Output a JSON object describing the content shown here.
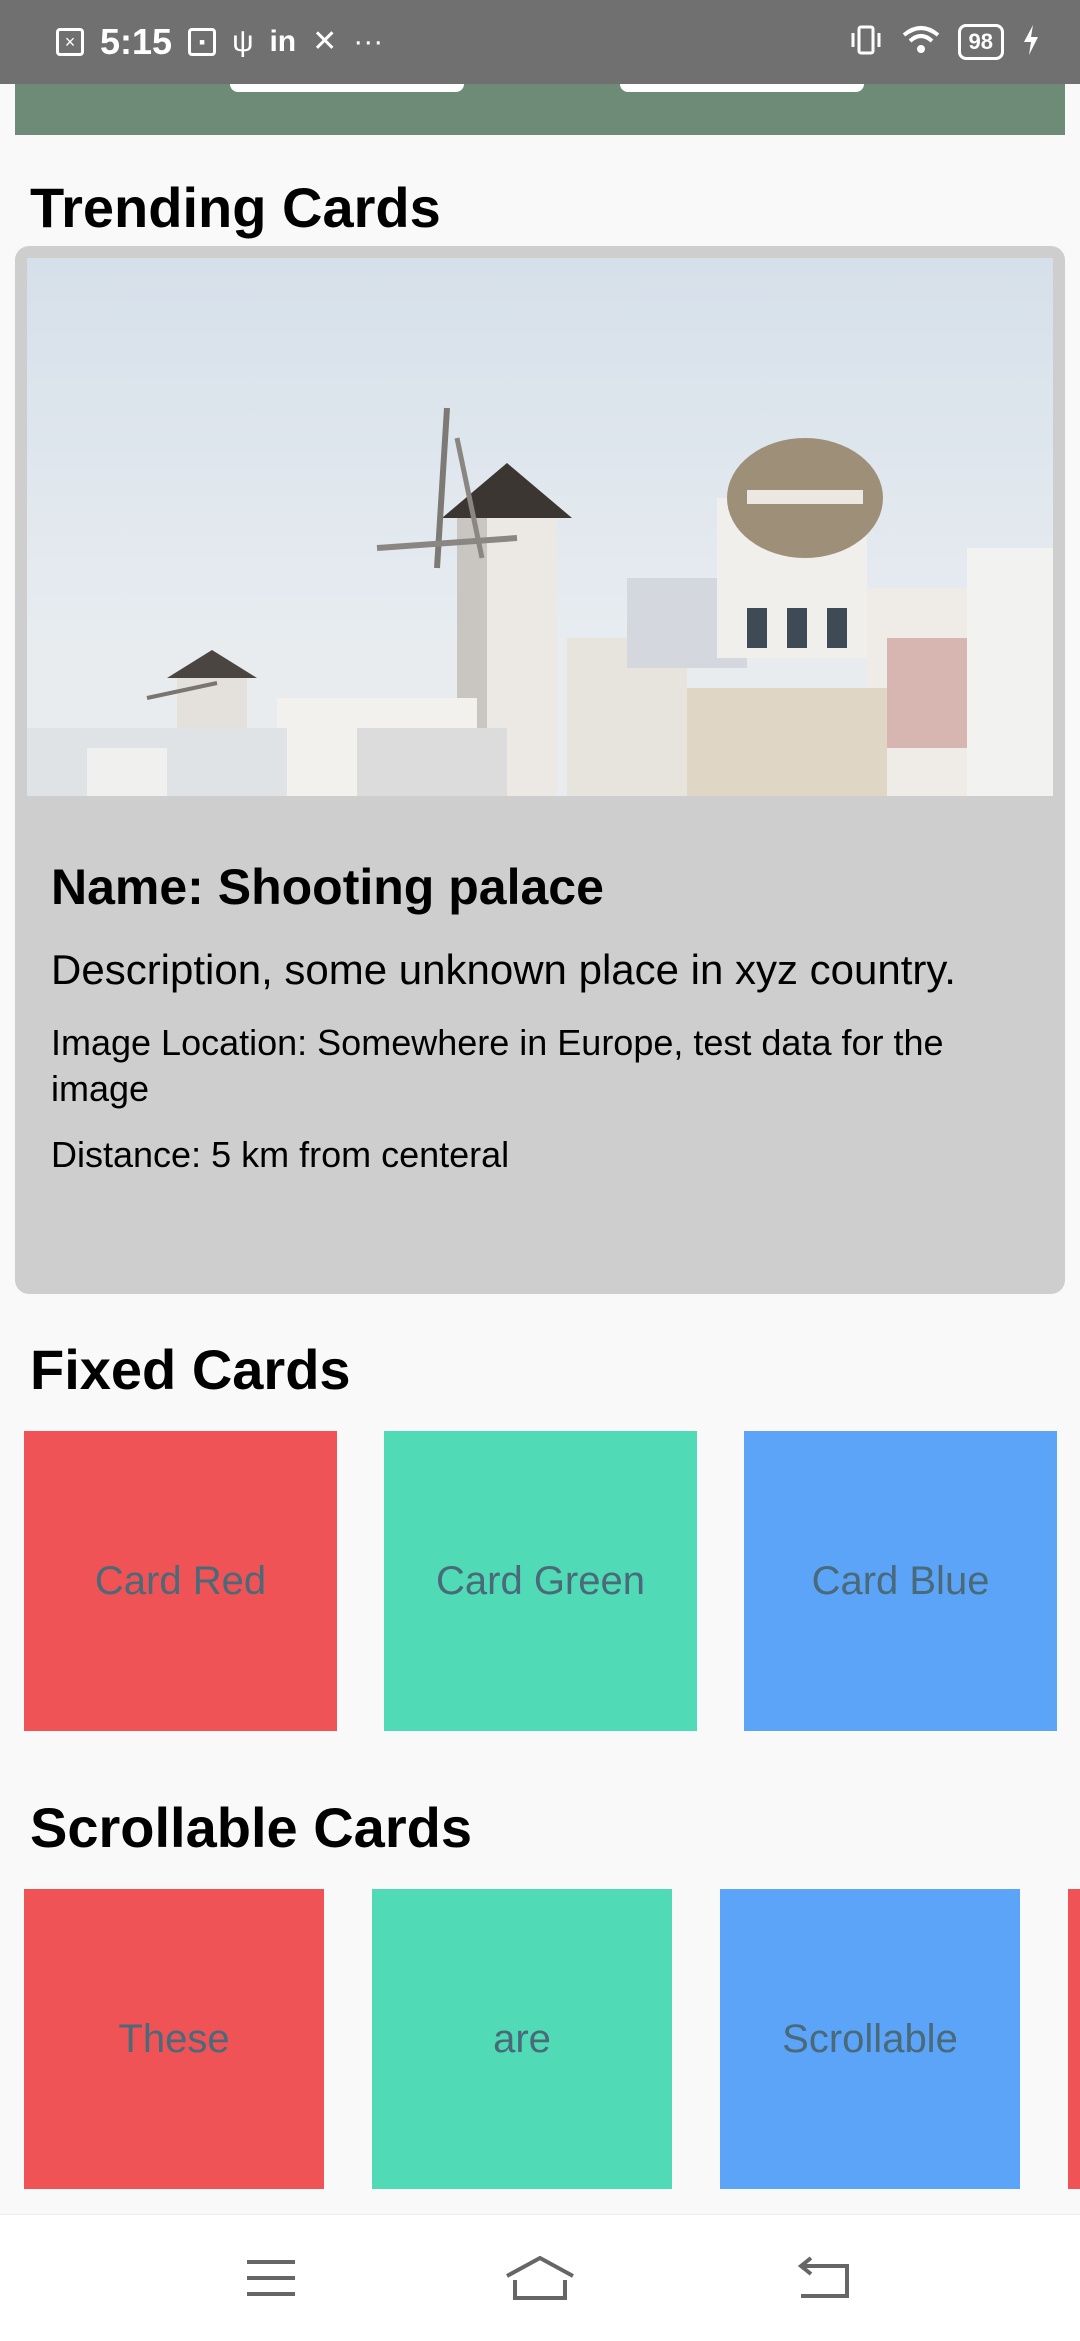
{
  "status_bar": {
    "time": "5:15",
    "battery": "98",
    "left_icons": [
      "screenshot-icon",
      "usb-debug-icon",
      "usb-icon",
      "linkedin-icon",
      "tools-icon",
      "more-icon"
    ],
    "right_icons": [
      "vibrate-icon",
      "wifi-icon",
      "battery-icon",
      "charging-icon"
    ],
    "linkedin_text": "in",
    "more_text": "···"
  },
  "sections": {
    "trending_title": "Trending Cards",
    "fixed_title": "Fixed Cards",
    "scrollable_title": "Scrollable Cards"
  },
  "trending_card": {
    "name": "Name: Shooting palace",
    "description": "Description, some unknown place in xyz country.",
    "location": "Image Location: Somewhere in Europe, test data for the image",
    "distance": "Distance: 5 km from centeral"
  },
  "fixed_cards": [
    {
      "label": "Card Red",
      "color": "#ef5355"
    },
    {
      "label": "Card Green",
      "color": "#50dbb6"
    },
    {
      "label": "Card Blue",
      "color": "#5ba4f8"
    }
  ],
  "scrollable_cards": [
    {
      "label": "These",
      "color": "#ef5355"
    },
    {
      "label": "are",
      "color": "#50dbb6"
    },
    {
      "label": "Scrollable",
      "color": "#5ba4f8"
    },
    {
      "label": "",
      "color": "#ef5355"
    }
  ],
  "nav_bar": {
    "icons": [
      "menu-icon",
      "home-icon",
      "back-icon"
    ]
  },
  "colors": {
    "status_bar": "#707070",
    "banner": "#6e8b78",
    "card_bg": "#cecece",
    "tile_text": "#4a6a79"
  }
}
